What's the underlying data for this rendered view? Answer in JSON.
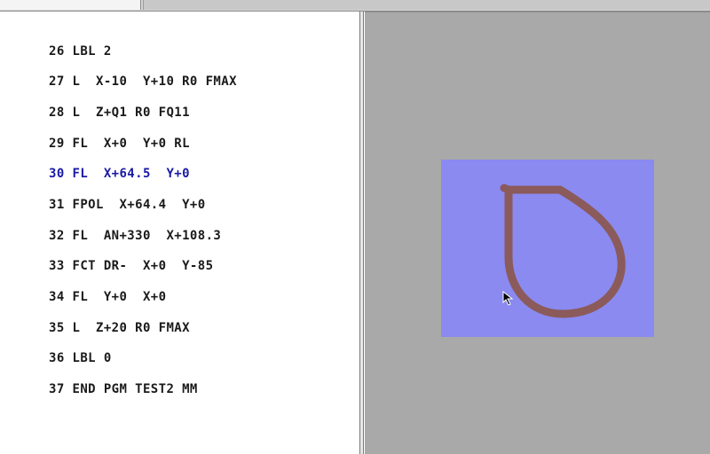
{
  "program": {
    "active_line": "30",
    "lines": [
      {
        "number": "26",
        "text": "LBL 2"
      },
      {
        "number": "27",
        "text": "L  X-10  Y+10 R0 FMAX"
      },
      {
        "number": "28",
        "text": "L  Z+Q1 R0 FQ11"
      },
      {
        "number": "29",
        "text": "FL  X+0  Y+0 RL"
      },
      {
        "number": "30",
        "text": "FL  X+64.5  Y+0"
      },
      {
        "number": "31",
        "text": "FPOL  X+64.4  Y+0"
      },
      {
        "number": "32",
        "text": "FL  AN+330  X+108.3"
      },
      {
        "number": "33",
        "text": "FCT DR-  X+0  Y-85"
      },
      {
        "number": "34",
        "text": "FL  Y+0  X+0"
      },
      {
        "number": "35",
        "text": "L  Z+20 R0 FMAX"
      },
      {
        "number": "36",
        "text": "LBL 0"
      },
      {
        "number": "37",
        "text": "END PGM TEST2 MM"
      }
    ]
  },
  "graphics": {
    "colors": {
      "background": "#a9a9a9",
      "workpiece": "#8a8af0",
      "tool_path": "#8b5a5a",
      "active_line": "#1a1aa6"
    },
    "icons": [
      "mouse-pointer-icon"
    ]
  }
}
